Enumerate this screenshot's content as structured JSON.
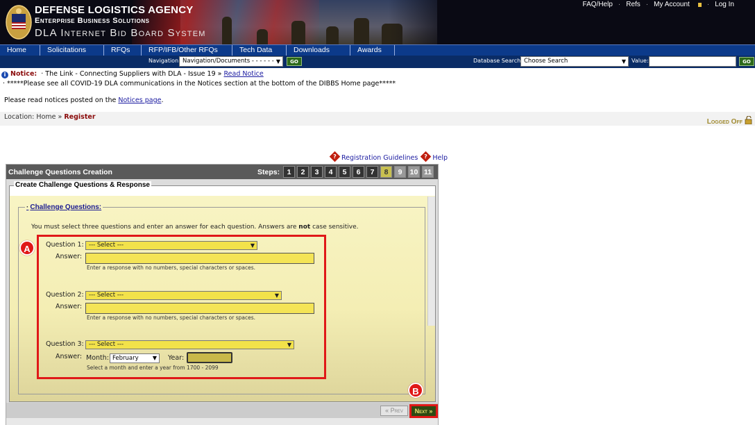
{
  "header": {
    "agency": "DEFENSE LOGISTICS AGENCY",
    "division": "Enterprise Business Solutions",
    "system": "DLA Internet Bid Board System",
    "links": {
      "faq": "FAQ/Help",
      "refs": "Refs",
      "account": "My Account",
      "login": "Log In"
    }
  },
  "nav": {
    "tabs": [
      "Home",
      "Solicitations",
      "RFQs",
      "RFP/IFB/Other RFQs",
      "Tech Data",
      "Downloads",
      "Awards"
    ]
  },
  "subbar": {
    "navigation_label": "Navigation:",
    "navigation_value": "Navigation/Documents - - - - - -",
    "go": "GO",
    "db_search_label": "Database Search:",
    "db_search_value": "Choose Search",
    "value_label": "Value:",
    "value_text": ""
  },
  "notices": {
    "label": "Notice:",
    "item": "· The Link - Connecting Suppliers with DLA - Issue 19 »",
    "read_link": "Read Notice",
    "covid": "· *****Please see all COVID-19 DLA communications in the Notices section at the bottom of the DIBBS Home page*****",
    "read_prefix": "Please read notices posted on the",
    "notices_link": "Notices page",
    "read_suffix": "."
  },
  "location": {
    "prefix": "Location:",
    "home": "Home",
    "sep": "»",
    "current": "Register",
    "status": "Logged Off"
  },
  "guides": {
    "registration": "Registration Guidelines",
    "help": "Help"
  },
  "panel": {
    "title": "Challenge Questions Creation",
    "steps_label": "Steps:",
    "steps": [
      "1",
      "2",
      "3",
      "4",
      "5",
      "6",
      "7",
      "8",
      "9",
      "10",
      "11"
    ],
    "active_step": 8,
    "section_title": "Create Challenge Questions & Response",
    "subsection_title": "Challenge Questions:",
    "instructions_1": "You must select three questions and enter an answer for each question.   Answers are",
    "instructions_not": "not",
    "instructions_2": "case sensitive."
  },
  "questions": [
    {
      "label": "Question 1:",
      "select": "--- Select ---",
      "answer_label": "Answer:",
      "answer": "",
      "hint": "Enter a response with no numbers, special characters or spaces."
    },
    {
      "label": "Question 2:",
      "select": "--- Select ---",
      "answer_label": "Answer:",
      "answer": "",
      "hint": "Enter a response with no numbers, special characters or spaces."
    },
    {
      "label": "Question 3:",
      "select": "--- Select ---",
      "answer_label": "Answer:",
      "month_label": "Month:",
      "month": "February",
      "year_label": "Year:",
      "year": "",
      "hint": "Select a month and enter a year from 1700 - 2099"
    }
  ],
  "annotations": {
    "a": "A",
    "b": "B"
  },
  "buttons": {
    "prev": "« Prev",
    "next": "Next »"
  },
  "colors": {
    "nav": "#0c3a8a",
    "highlight": "#e01818",
    "field": "#f2e24a",
    "panel_title": "#5a5a5a"
  }
}
